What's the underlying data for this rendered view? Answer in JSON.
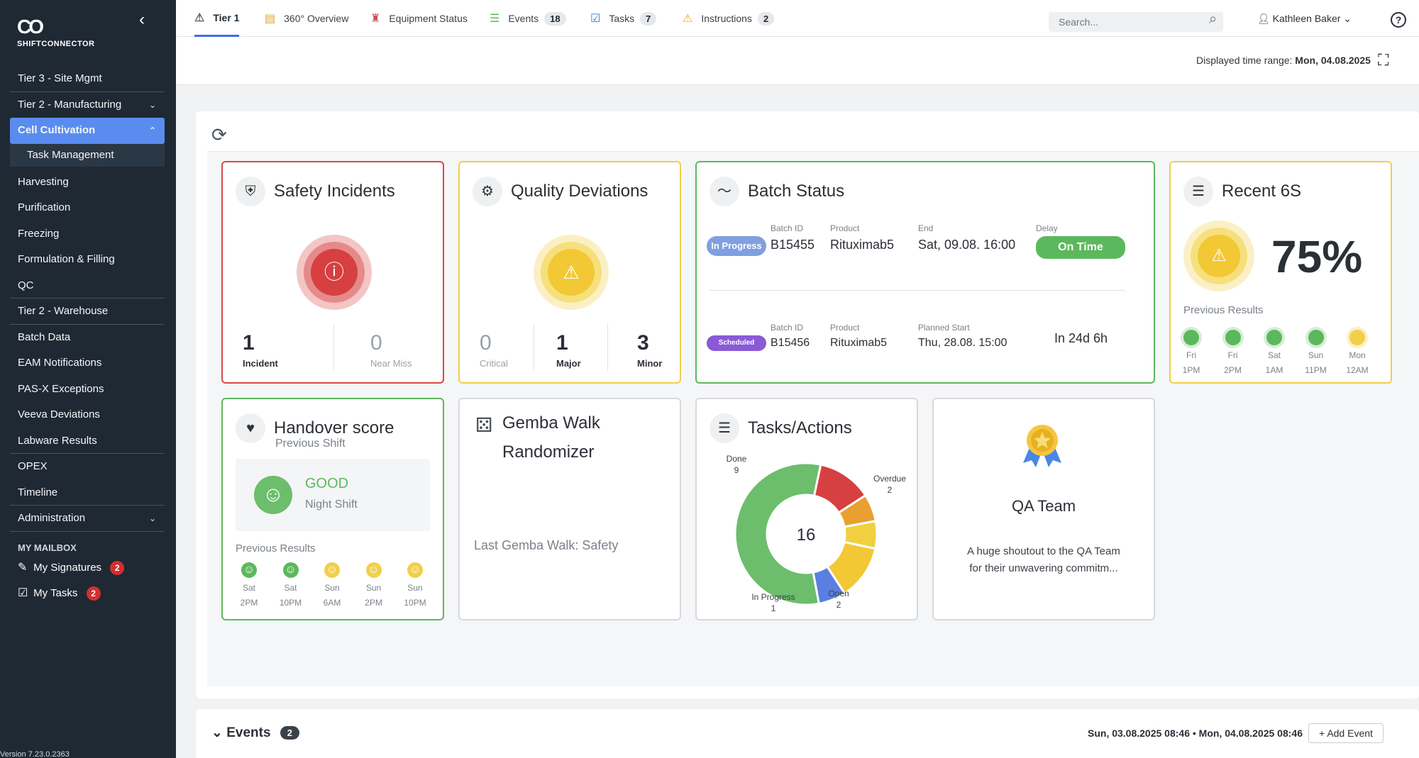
{
  "sidebar": {
    "brand": "SHIFTCONNECTOR",
    "items": [
      {
        "label": "Tier 3 - Site Mgmt"
      },
      {
        "label": "Tier 2 - Manufacturing"
      },
      {
        "label": "Cell Cultivation"
      },
      {
        "label": "Task Management"
      },
      {
        "label": "Harvesting"
      },
      {
        "label": "Purification"
      },
      {
        "label": "Freezing"
      },
      {
        "label": "Formulation & Filling"
      },
      {
        "label": "QC"
      },
      {
        "label": "Tier 2 - Warehouse"
      },
      {
        "label": "Batch Data"
      },
      {
        "label": "EAM Notifications"
      },
      {
        "label": "PAS-X Exceptions"
      },
      {
        "label": "Veeva Deviations"
      },
      {
        "label": "Labware Results"
      },
      {
        "label": "OPEX"
      },
      {
        "label": "Timeline"
      },
      {
        "label": "Administration"
      }
    ],
    "mailbox_title": "MY MAILBOX",
    "mailbox": [
      {
        "label": "My Signatures",
        "count": "2"
      },
      {
        "label": "My Tasks",
        "count": "2"
      }
    ],
    "version": "Version 7.23.0.2363"
  },
  "tabs": [
    {
      "label": "Tier 1",
      "icon": "warning-outline-icon",
      "badge": ""
    },
    {
      "label": "360° Overview",
      "icon": "overview-icon",
      "badge": ""
    },
    {
      "label": "Equipment Status",
      "icon": "equipment-icon",
      "badge": ""
    },
    {
      "label": "Events",
      "icon": "list-icon",
      "badge": "18"
    },
    {
      "label": "Tasks",
      "icon": "checkbox-icon",
      "badge": "7"
    },
    {
      "label": "Instructions",
      "icon": "warning-yellow-icon",
      "badge": "2"
    }
  ],
  "search": {
    "placeholder": "Search..."
  },
  "user": {
    "name": "Kathleen Baker"
  },
  "time_range": {
    "label": "Displayed time range:",
    "value": "Mon, 04.08.2025"
  },
  "cards": {
    "safety": {
      "title": "Safety Incidents",
      "incident_count": "1",
      "incident_label": "Incident",
      "near_miss_count": "0",
      "near_miss_label": "Near Miss",
      "color": "#d84848"
    },
    "quality": {
      "title": "Quality Deviations",
      "critical_count": "0",
      "critical_label": "Critical",
      "major_count": "1",
      "major_label": "Major",
      "minor_count": "3",
      "minor_label": "Minor",
      "color": "#f0cf4a"
    },
    "batch": {
      "title": "Batch Status",
      "rows": [
        {
          "status": "In Progress",
          "status_color": "#7f9fe0",
          "batch_id_label": "Batch ID",
          "batch_id": "B15455",
          "product_label": "Product",
          "product": "Rituximab5",
          "time_label": "End",
          "time": "Sat, 09.08. 16:00",
          "delay_label": "Delay",
          "delay": "On Time",
          "delay_color": "#5cb85c"
        },
        {
          "status": "Scheduled",
          "status_color": "#8a5ad6",
          "batch_id_label": "Batch ID",
          "batch_id": "B15456",
          "product_label": "Product",
          "product": "Rituximab5",
          "time_label": "Planned Start",
          "time": "Thu, 28.08. 15:00",
          "delay_label": "",
          "delay": "In 24d 6h"
        }
      ]
    },
    "six_s": {
      "title": "Recent 6S",
      "percent": "75%",
      "previous_label": "Previous Results",
      "results": [
        {
          "day": "Fri",
          "time": "1PM",
          "color": "#5cb85c"
        },
        {
          "day": "Fri",
          "time": "2PM",
          "color": "#5cb85c"
        },
        {
          "day": "Sat",
          "time": "1AM",
          "color": "#5cb85c"
        },
        {
          "day": "Sun",
          "time": "11PM",
          "color": "#5cb85c"
        },
        {
          "day": "Mon",
          "time": "12AM",
          "color": "#f0cf4a"
        }
      ]
    },
    "handover": {
      "title": "Handover score",
      "subtitle": "Previous Shift",
      "score": "GOOD",
      "shift": "Night Shift",
      "previous_label": "Previous Results",
      "results": [
        {
          "day": "Sat",
          "time": "2PM",
          "color": "#5cb85c"
        },
        {
          "day": "Sat",
          "time": "10PM",
          "color": "#5cb85c"
        },
        {
          "day": "Sun",
          "time": "6AM",
          "color": "#f0cf4a"
        },
        {
          "day": "Sun",
          "time": "2PM",
          "color": "#f0cf4a"
        },
        {
          "day": "Sun",
          "time": "10PM",
          "color": "#f0cf4a"
        }
      ]
    },
    "gemba": {
      "title_line1": "Gemba Walk",
      "title_line2": "Randomizer",
      "last": "Last Gemba Walk: Safety"
    },
    "tasks": {
      "title": "Tasks/Actions",
      "total": "16"
    },
    "qa": {
      "title": "QA Team",
      "text_line1": "A huge shoutout to the QA Team",
      "text_line2": "for their unwavering commitm..."
    }
  },
  "chart_data": {
    "type": "pie",
    "title": "Tasks/Actions",
    "center_label": "16",
    "slices": [
      {
        "label": "Done",
        "value": 9,
        "color": "#6cbd6c"
      },
      {
        "label": "Overdue",
        "value": 2,
        "color": "#d64040"
      },
      {
        "label": "Open",
        "value": 2,
        "color": "#f2c835"
      },
      {
        "label": "",
        "value": 1,
        "color": "#e8a030"
      },
      {
        "label": "",
        "value": 1,
        "color": "#f0d040"
      },
      {
        "label": "In Progress",
        "value": 1,
        "color": "#5a7fe0"
      }
    ]
  },
  "events": {
    "title": "Events",
    "count": "2",
    "range": "Sun, 03.08.2025 08:46 • Mon, 04.08.2025 08:46",
    "add_label": "Add Event"
  }
}
